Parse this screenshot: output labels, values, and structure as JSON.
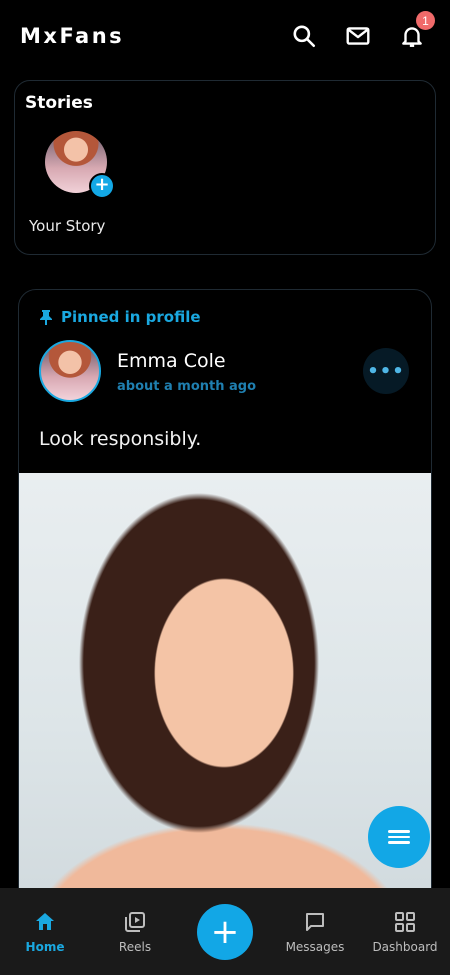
{
  "app": {
    "title": "MxFans"
  },
  "header": {
    "notification_count": "1",
    "icons": [
      "search-icon",
      "mail-icon",
      "bell-icon"
    ]
  },
  "stories": {
    "title": "Stories",
    "items": [
      {
        "label": "Your Story"
      }
    ]
  },
  "post": {
    "pinned_label": "Pinned in profile",
    "author_name": "Emma Cole",
    "time": "about a month ago",
    "text": "Look responsibly."
  },
  "bottom_nav": {
    "items": [
      {
        "label": "Home",
        "icon": "home-icon",
        "active": true
      },
      {
        "label": "Reels",
        "icon": "reels-icon",
        "active": false
      },
      {
        "label": "",
        "icon": "add-icon",
        "active": false
      },
      {
        "label": "Messages",
        "icon": "message-icon",
        "active": false
      },
      {
        "label": "Dashboard",
        "icon": "dashboard-icon",
        "active": false
      }
    ]
  },
  "colors": {
    "accent": "#12a7e6",
    "badge": "#f06a6a",
    "background": "#000000",
    "nav_bg": "#1a1a1a"
  }
}
